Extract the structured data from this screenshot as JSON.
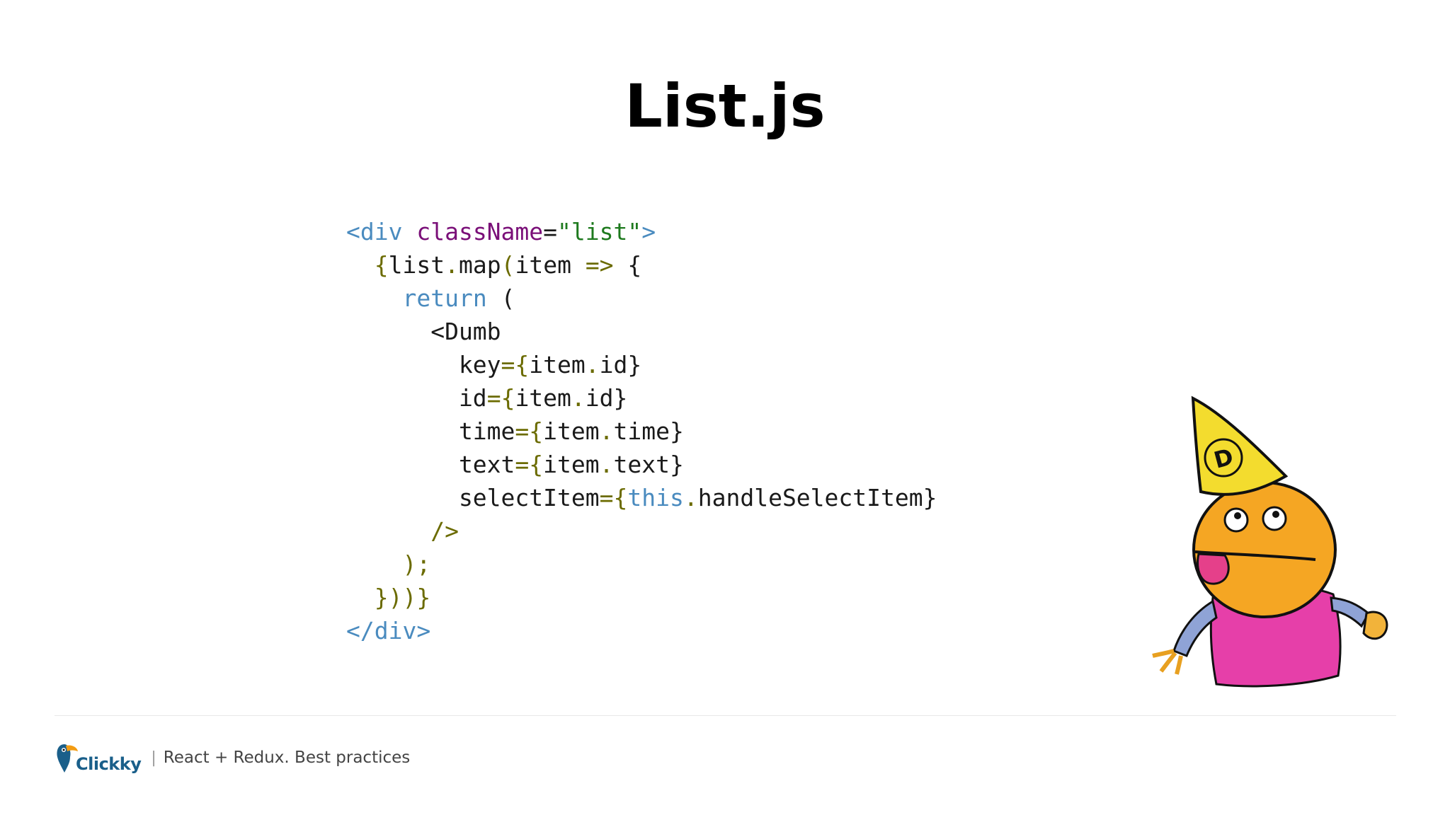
{
  "slide": {
    "title": "List.js"
  },
  "code": {
    "lines": [
      [
        [
          "tag",
          "<div "
        ],
        [
          "attr",
          "className"
        ],
        [
          "plain",
          "="
        ],
        [
          "str",
          "\"list\""
        ],
        [
          "tag",
          ">"
        ]
      ],
      [
        [
          "plain",
          "  "
        ],
        [
          "punct",
          "{"
        ],
        [
          "plain",
          "list"
        ],
        [
          "punct",
          "."
        ],
        [
          "plain",
          "map"
        ],
        [
          "punct",
          "("
        ],
        [
          "plain",
          "item "
        ],
        [
          "punct",
          "=>"
        ],
        [
          "plain",
          " {"
        ]
      ],
      [
        [
          "plain",
          "    "
        ],
        [
          "kw",
          "return"
        ],
        [
          "plain",
          " ("
        ]
      ],
      [
        [
          "plain",
          "      <Dumb"
        ]
      ],
      [
        [
          "plain",
          "        key"
        ],
        [
          "punct",
          "="
        ],
        [
          "punct",
          "{"
        ],
        [
          "plain",
          "item"
        ],
        [
          "punct",
          "."
        ],
        [
          "plain",
          "id}"
        ]
      ],
      [
        [
          "plain",
          "        id"
        ],
        [
          "punct",
          "="
        ],
        [
          "punct",
          "{"
        ],
        [
          "plain",
          "item"
        ],
        [
          "punct",
          "."
        ],
        [
          "plain",
          "id}"
        ]
      ],
      [
        [
          "plain",
          "        time"
        ],
        [
          "punct",
          "="
        ],
        [
          "punct",
          "{"
        ],
        [
          "plain",
          "item"
        ],
        [
          "punct",
          "."
        ],
        [
          "plain",
          "time}"
        ]
      ],
      [
        [
          "plain",
          "        text"
        ],
        [
          "punct",
          "="
        ],
        [
          "punct",
          "{"
        ],
        [
          "plain",
          "item"
        ],
        [
          "punct",
          "."
        ],
        [
          "plain",
          "text}"
        ]
      ],
      [
        [
          "plain",
          "        selectItem"
        ],
        [
          "punct",
          "="
        ],
        [
          "punct",
          "{"
        ],
        [
          "kw",
          "this"
        ],
        [
          "punct",
          "."
        ],
        [
          "plain",
          "handleSelectItem}"
        ]
      ],
      [
        [
          "plain",
          "      "
        ],
        [
          "punct",
          "/>"
        ]
      ],
      [
        [
          "plain",
          "    "
        ],
        [
          "punct",
          ");"
        ]
      ],
      [
        [
          "plain",
          "  "
        ],
        [
          "punct",
          "}))"
        ],
        [
          "punct",
          "}"
        ]
      ],
      [
        [
          "tag",
          "</div>"
        ]
      ]
    ]
  },
  "footer": {
    "logo_text": "Clickky",
    "separator": "|",
    "caption": "React + Redux. Best practices"
  },
  "mascot": {
    "hat_letter": "D"
  },
  "colors": {
    "tag": "#4a8bbf",
    "attr": "#7a0f78",
    "string": "#1e7a1e",
    "punct": "#6b6b00",
    "keyword": "#4a8bbf",
    "logo": "#1a5f8a"
  }
}
